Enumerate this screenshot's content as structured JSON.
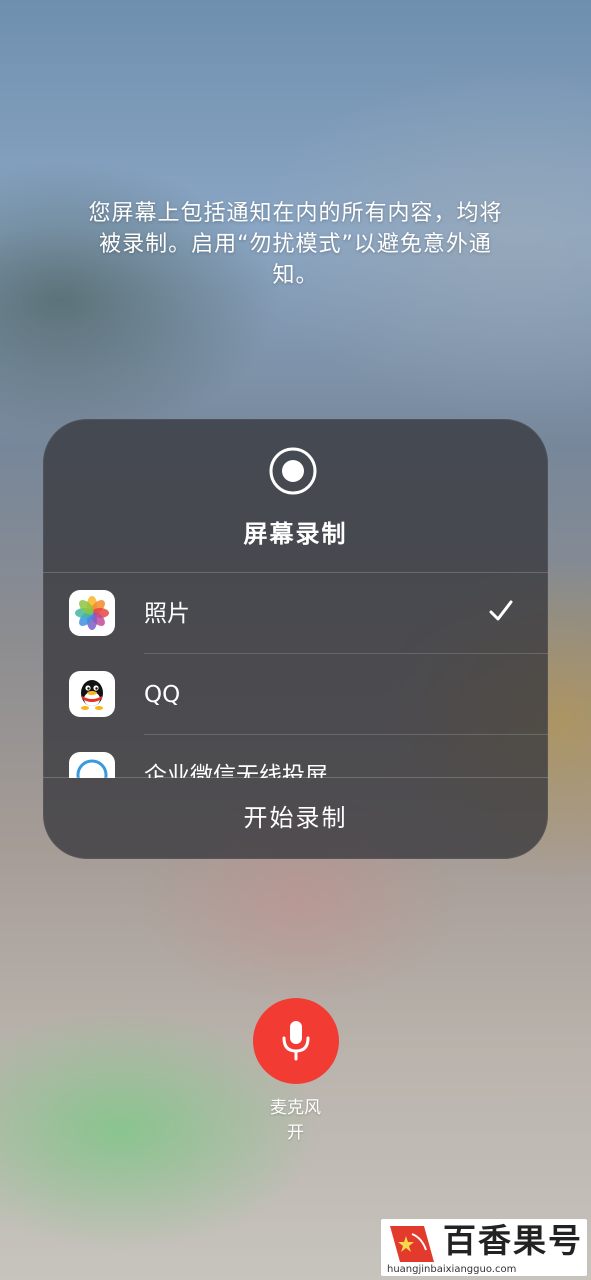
{
  "notice": {
    "line1": "您屏幕上包括通知在内的所有内容，均将",
    "line2": "被录制。启用“勿扰模式”以避免意外通",
    "line3": "知。"
  },
  "panel": {
    "title": "屏幕录制",
    "items": [
      {
        "label": "照片",
        "icon": "photos-app-icon",
        "selected": true
      },
      {
        "label": "QQ",
        "icon": "qq-app-icon",
        "selected": false
      },
      {
        "label": "企业微信无线投屏",
        "icon": "wecom-cast-app-icon",
        "selected": false
      }
    ],
    "start_label": "开始录制"
  },
  "microphone": {
    "label": "麦克风",
    "state": "开",
    "color": "#f23b33"
  },
  "watermark": {
    "name": "百香果号",
    "url": "huangjinbaixiangguo.com"
  }
}
